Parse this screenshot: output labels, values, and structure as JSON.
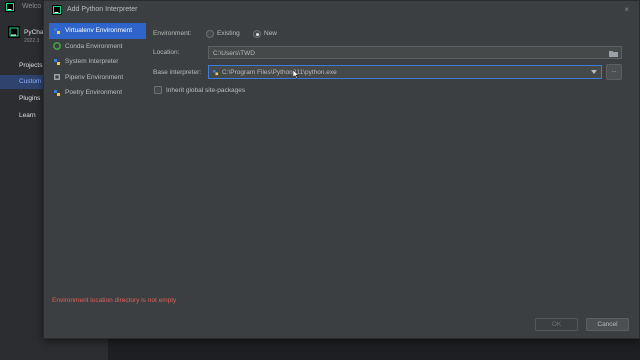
{
  "background_window": {
    "title": "Welco",
    "product_name": "PyCha",
    "product_version": "2022.3",
    "nav": [
      {
        "label": "Projects"
      },
      {
        "label": "Custom"
      },
      {
        "label": "Plugins"
      },
      {
        "label": "Learn"
      }
    ],
    "active_nav": "Custom"
  },
  "dialog": {
    "title": "Add Python Interpreter",
    "close_glyph": "×",
    "env_types": [
      {
        "label": "Virtualenv Environment",
        "icon": "virtualenv-icon",
        "selected": true
      },
      {
        "label": "Conda Environment",
        "icon": "conda-icon",
        "selected": false
      },
      {
        "label": "System Interpreter",
        "icon": "python-icon",
        "selected": false
      },
      {
        "label": "Pipenv Environment",
        "icon": "pipenv-icon",
        "selected": false
      },
      {
        "label": "Poetry Environment",
        "icon": "poetry-icon",
        "selected": false
      }
    ],
    "environment": {
      "label": "Environment:",
      "options": [
        "Existing",
        "New"
      ],
      "selected": "New"
    },
    "location": {
      "label": "Location:",
      "value": "C:\\Users\\TWD"
    },
    "base_interpreter": {
      "label": "Base interpreter:",
      "value": "C:\\Program Files\\Python311\\python.exe",
      "browse_label": "..."
    },
    "inherit": {
      "label": "Inherit global site-packages",
      "checked": false
    },
    "error": "Environment location directory is not empty",
    "buttons": {
      "ok": "OK",
      "cancel": "Cancel"
    }
  },
  "colors": {
    "accent": "#2f65ca",
    "error": "#e0605a",
    "dialog_bg": "#3c3f41",
    "focus_border": "#3d7bd9"
  }
}
